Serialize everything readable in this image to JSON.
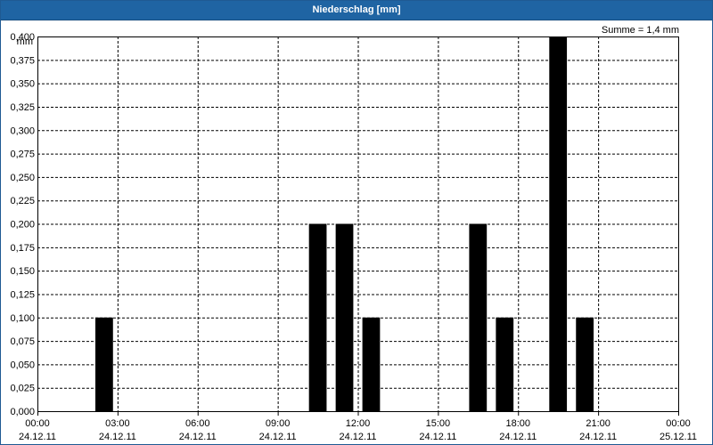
{
  "window": {
    "title": "Niederschlag [mm]"
  },
  "summary": "Summe = 1,4 mm",
  "colors": {
    "titlebar": "#1f64a3",
    "bar": "#000000",
    "grid": "#000000",
    "background": "#ffffff"
  },
  "chart_data": {
    "type": "bar",
    "title": "Niederschlag [mm]",
    "ylabel": "mm",
    "ylim": [
      0,
      0.4
    ],
    "yticks": [
      "0,000",
      "0,025",
      "0,050",
      "0,075",
      "0,100",
      "0,125",
      "0,150",
      "0,175",
      "0,200",
      "0,225",
      "0,250",
      "0,275",
      "0,300",
      "0,325",
      "0,350",
      "0,375",
      "0,400"
    ],
    "xlim_hours": [
      0,
      24
    ],
    "xticks": [
      {
        "time": "00:00",
        "date": "24.12.11"
      },
      {
        "time": "03:00",
        "date": "24.12.11"
      },
      {
        "time": "06:00",
        "date": "24.12.11"
      },
      {
        "time": "09:00",
        "date": "24.12.11"
      },
      {
        "time": "12:00",
        "date": "24.12.11"
      },
      {
        "time": "15:00",
        "date": "24.12.11"
      },
      {
        "time": "18:00",
        "date": "24.12.11"
      },
      {
        "time": "21:00",
        "date": "24.12.11"
      },
      {
        "time": "00:00",
        "date": "25.12.11"
      }
    ],
    "interval_hours": 1,
    "bars": [
      {
        "hour": 3,
        "value": 0.1
      },
      {
        "hour": 11,
        "value": 0.2
      },
      {
        "hour": 12,
        "value": 0.2
      },
      {
        "hour": 13,
        "value": 0.1
      },
      {
        "hour": 17,
        "value": 0.2
      },
      {
        "hour": 18,
        "value": 0.1
      },
      {
        "hour": 20,
        "value": 0.4
      },
      {
        "hour": 21,
        "value": 0.1
      }
    ],
    "grid": true,
    "legend": "none"
  }
}
